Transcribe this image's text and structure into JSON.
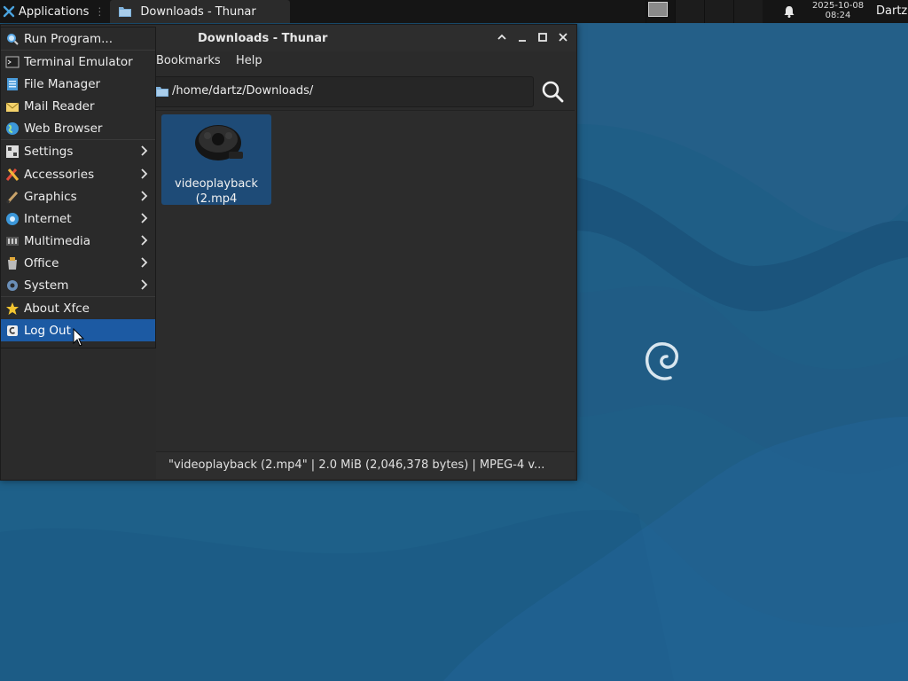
{
  "panel": {
    "applications_label": "Applications",
    "task_title": "Downloads - Thunar",
    "datetime_date": "2025-10-08",
    "datetime_time": "08:24",
    "user": "Dartz"
  },
  "window": {
    "title": "Downloads - Thunar",
    "menus": [
      "Bookmarks",
      "Help"
    ],
    "path": "/home/dartz/Downloads/",
    "files": [
      {
        "name": "videoplayback (2.mp4",
        "name_line1": "videoplayback",
        "name_line2": "(2.mp4",
        "selected": true
      }
    ],
    "status": "\"videoplayback (2.mp4\"  |  2.0 MiB (2,046,378 bytes)  |  MPEG-4 v..."
  },
  "app_menu": {
    "items": [
      {
        "label": "Run Program...",
        "icon": "run-icon",
        "submenu": false
      },
      {
        "label": "Terminal Emulator",
        "icon": "terminal-icon",
        "submenu": false
      },
      {
        "label": "File Manager",
        "icon": "file-manager-icon",
        "submenu": false
      },
      {
        "label": "Mail Reader",
        "icon": "mail-icon",
        "submenu": false
      },
      {
        "label": "Web Browser",
        "icon": "globe-icon",
        "submenu": false
      },
      {
        "label": "Settings",
        "icon": "settings-icon",
        "submenu": true
      },
      {
        "label": "Accessories",
        "icon": "accessories-icon",
        "submenu": true
      },
      {
        "label": "Graphics",
        "icon": "graphics-icon",
        "submenu": true
      },
      {
        "label": "Internet",
        "icon": "internet-icon",
        "submenu": true
      },
      {
        "label": "Multimedia",
        "icon": "multimedia-icon",
        "submenu": true
      },
      {
        "label": "Office",
        "icon": "office-icon",
        "submenu": true
      },
      {
        "label": "System",
        "icon": "system-icon",
        "submenu": true
      },
      {
        "label": "About Xfce",
        "icon": "star-icon",
        "submenu": false
      },
      {
        "label": "Log Out",
        "icon": "logout-icon",
        "submenu": false,
        "active": true
      }
    ]
  },
  "colors": {
    "desktop": "#1f5e86",
    "panel": "#151515",
    "selection": "#1c5aa3",
    "file_selected": "#1e4b77"
  }
}
